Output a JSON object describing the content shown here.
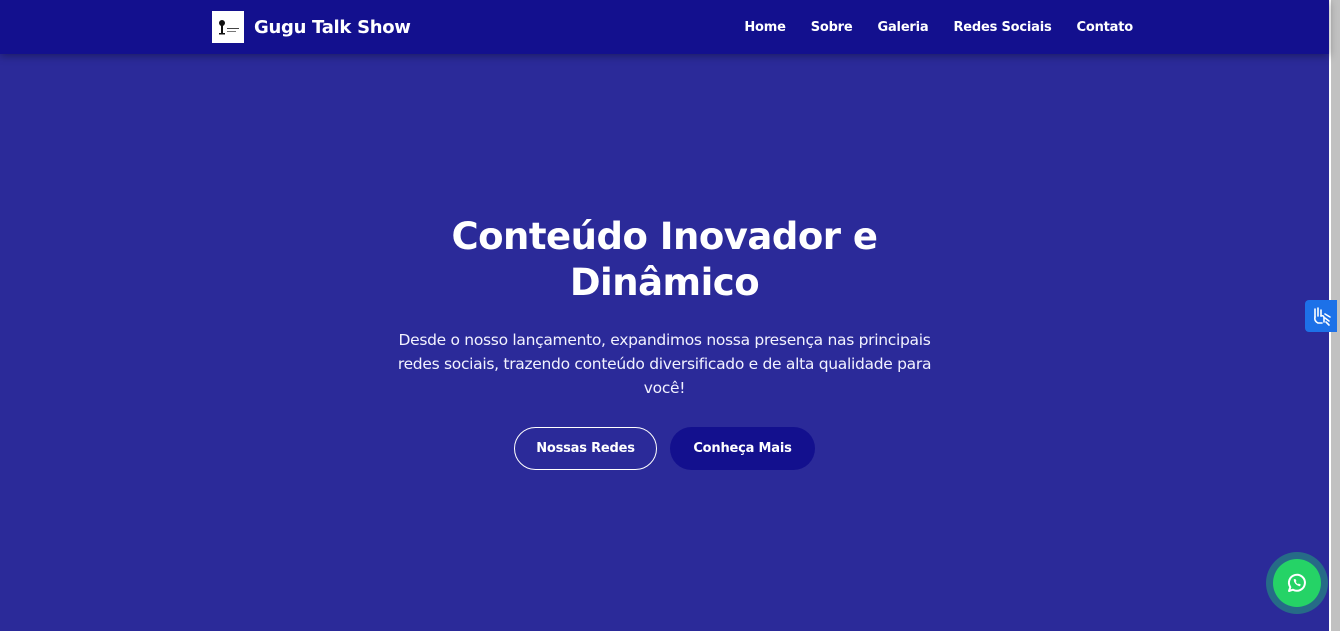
{
  "navbar": {
    "brand_name": "Gugu Talk Show",
    "logo_icon": "microphone-logo-icon",
    "links": [
      "Home",
      "Sobre",
      "Galeria",
      "Redes Sociais",
      "Contato"
    ]
  },
  "hero": {
    "title": "Conteúdo Inovador e Dinâmico",
    "text": "Desde o nosso lançamento, expandimos nossa presença nas principais redes sociais, trazendo conteúdo diversificado e de alta qualidade para você!",
    "primary_button": "Nossas Redes",
    "secondary_button": "Conheça Mais"
  },
  "widgets": {
    "accessibility_icon": "sign-language-hands-icon",
    "whatsapp_icon": "whatsapp-icon"
  },
  "colors": {
    "navbar_bg": "#13108e",
    "hero_bg": "#2b2a99",
    "button_solid": "#13108e",
    "whatsapp": "#25d366",
    "vlibras": "#1d71e8"
  }
}
